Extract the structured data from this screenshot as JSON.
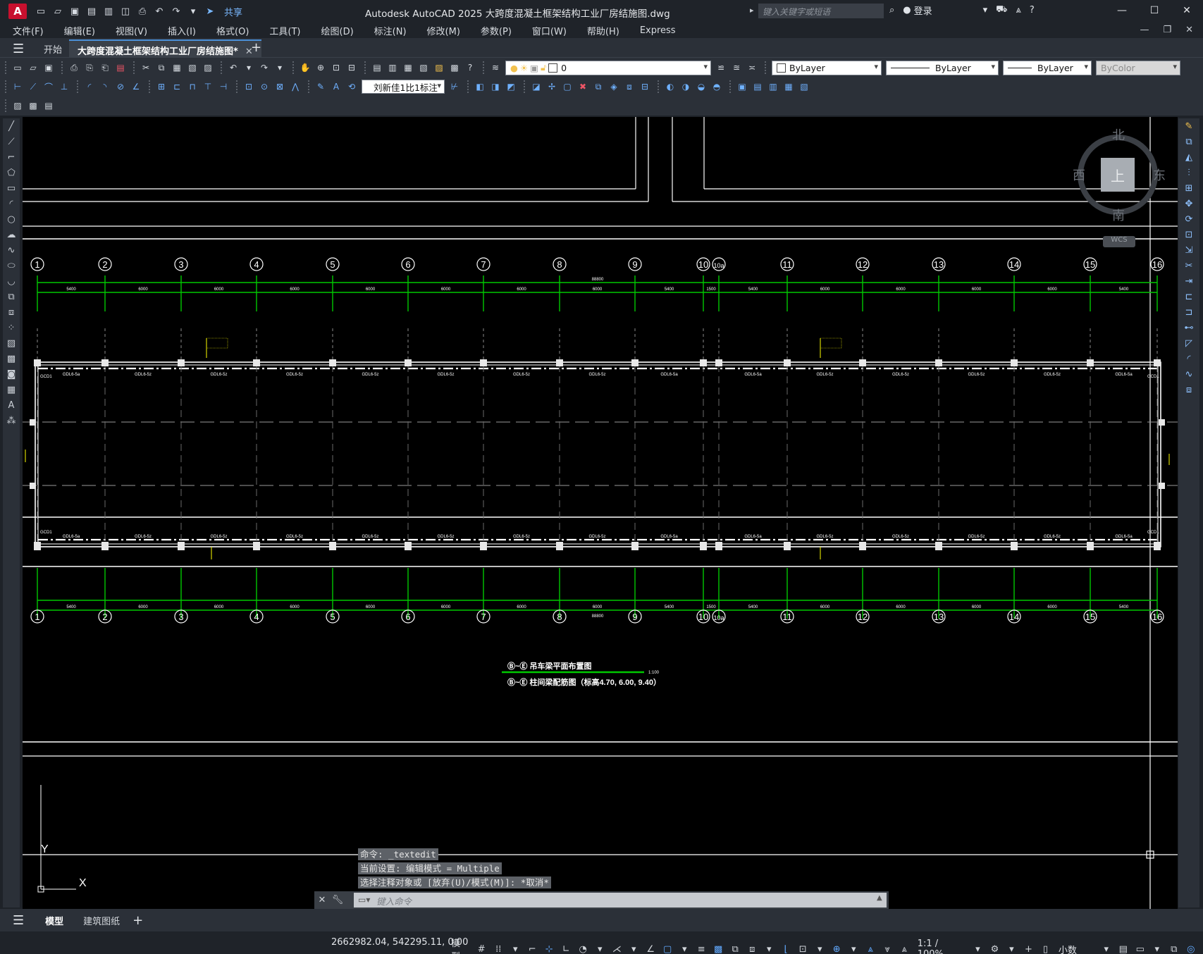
{
  "app": {
    "logo": "A",
    "window_title": "Autodesk AutoCAD 2025    大跨度混凝土框架结构工业厂房结施图.dwg",
    "search_placeholder": "键入关键字或短语",
    "share_label": "共享",
    "login_label": "登录"
  },
  "menu": [
    "文件(F)",
    "编辑(E)",
    "视图(V)",
    "插入(I)",
    "格式(O)",
    "工具(T)",
    "绘图(D)",
    "标注(N)",
    "修改(M)",
    "参数(P)",
    "窗口(W)",
    "帮助(H)",
    "Express"
  ],
  "file_tabs": {
    "start": "开始",
    "active": "大跨度混凝土框架结构工业厂房结施图*"
  },
  "toolbar": {
    "layer_value": "0",
    "color_value": "ByLayer",
    "linetype_value": "ByLayer",
    "lineweight_value": "ByLayer",
    "plotstyle_value": "ByColor",
    "dimstyle_value": "刘新佳1比1标注"
  },
  "viewcube": {
    "north": "北",
    "south": "南",
    "east": "东",
    "west": "西",
    "top": "上",
    "wcs": "WCS"
  },
  "drawing": {
    "axis_labels": [
      "1",
      "2",
      "3",
      "4",
      "5",
      "6",
      "7",
      "8",
      "9",
      "10",
      "10a",
      "11",
      "12",
      "13",
      "14",
      "15",
      "16"
    ],
    "top_spans": [
      "5400",
      "6000",
      "6000",
      "6000",
      "6000",
      "6000",
      "6000",
      "6000",
      "5400",
      "1500",
      "5400",
      "6000",
      "6000",
      "6000",
      "6000",
      "5400"
    ],
    "bottom_spans": [
      "5400",
      "6000",
      "6000",
      "6000",
      "6000",
      "6000",
      "6000",
      "6000",
      "5400",
      "1500",
      "5400",
      "6000",
      "6000",
      "6000",
      "6000",
      "5400"
    ],
    "total_top": "88800",
    "total_bottom": "88800",
    "top_beam_labels": [
      "GDL6-5a",
      "GDL6-5z",
      "GDL6-5z",
      "GDL6-5z",
      "GDL6-5z",
      "GDL6-5z",
      "GDL6-5z",
      "GDL6-5z",
      "GDL6-5a",
      "",
      "GDL6-5a",
      "GDL6-5z",
      "GDL6-5z",
      "GDL6-5z",
      "GDL6-5z",
      "GDL6-5a"
    ],
    "bottom_beam_labels": [
      "GDL6-5a",
      "GDL6-5z",
      "GDL6-5z",
      "GDL6-5z",
      "GDL6-5z",
      "GDL6-5z",
      "GDL6-5z",
      "GDL6-5z",
      "GDL6-5a",
      "",
      "GDL6-5a",
      "GDL6-5z",
      "GDL6-5z",
      "GDL6-5z",
      "GDL6-5z",
      "GDL6-5a"
    ],
    "corner_label": "GCD1",
    "title1": "Ⓑ~Ⓔ 吊车梁平面布置图",
    "title2": "Ⓑ~Ⓔ 柱间梁配筋图（标高4.70, 6.00, 9.40）",
    "scale": "1:100",
    "ucs_x": "X",
    "ucs_y": "Y"
  },
  "command": {
    "history": [
      "命令: _textedit",
      "当前设置: 编辑模式 = Multiple",
      "选择注释对象或 [放弃(U)/模式(M)]: *取消*"
    ],
    "placeholder": "键入命令"
  },
  "layout_tabs": [
    "模型",
    "建筑图纸"
  ],
  "status": {
    "coords": "2662982.04, 542295.11, 0.00",
    "model_label": "模型",
    "annoscale": "1:1 / 100%",
    "units": "小数"
  },
  "colors": {
    "canvas_bg": "#000000",
    "grid_green": "#00c800",
    "yellow_text": "#ffff00",
    "accent_blue": "#4a90d9"
  }
}
